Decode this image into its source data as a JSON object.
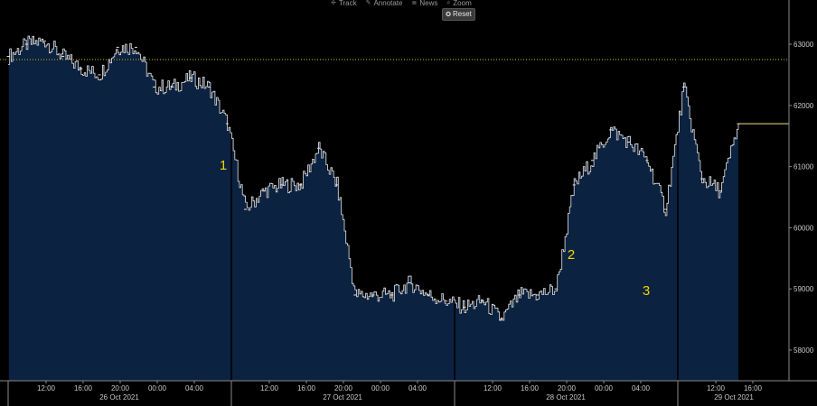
{
  "toolbar": {
    "track_label": "Track",
    "annotate_label": "Annotate",
    "news_label": "News",
    "zoom_label": "Zoom",
    "reset_label": "Reset"
  },
  "colors": {
    "background": "#000000",
    "area_fill": "#0b2240",
    "price_line": "#e6e6e6",
    "reference_line": "#d4c200",
    "annotation": "#f2d600",
    "last_price_line": "#f2e38a"
  },
  "chart_data": {
    "type": "area",
    "title": "",
    "xlabel": "",
    "ylabel": "",
    "ylim": [
      57500,
      63500
    ],
    "y_ticks": [
      58000,
      59000,
      60000,
      61000,
      62000,
      63000
    ],
    "reference_line": 62750,
    "x_hour_ticks": [
      "12:00",
      "16:00",
      "20:00",
      "00:00",
      "04:00",
      "12:00",
      "16:00",
      "20:00",
      "00:00",
      "04:00",
      "12:00",
      "16:00",
      "20:00",
      "00:00",
      "04:00",
      "12:00",
      "16:00"
    ],
    "x_date_labels": [
      "26 Oct 2021",
      "27 Oct 2021",
      "28 Oct 2021",
      "29 Oct 2021"
    ],
    "annotations": [
      "1",
      "2",
      "3"
    ],
    "x": [
      "26 Oct 06:00",
      "26 Oct 08:00",
      "26 Oct 10:00",
      "26 Oct 12:00",
      "26 Oct 14:00",
      "26 Oct 16:00",
      "26 Oct 18:00",
      "26 Oct 20:00",
      "26 Oct 22:00",
      "27 Oct 00:00",
      "27 Oct 02:00",
      "27 Oct 04:00",
      "27 Oct 06:00",
      "27 Oct 08:00",
      "27 Oct 10:00",
      "27 Oct 12:00",
      "27 Oct 14:00",
      "27 Oct 16:00",
      "27 Oct 18:00",
      "27 Oct 20:00",
      "27 Oct 22:00",
      "28 Oct 00:00",
      "28 Oct 02:00",
      "28 Oct 04:00",
      "28 Oct 06:00",
      "28 Oct 08:00",
      "28 Oct 10:00",
      "28 Oct 12:00",
      "28 Oct 14:00",
      "28 Oct 16:00",
      "28 Oct 18:00",
      "28 Oct 20:00",
      "28 Oct 22:00",
      "29 Oct 00:00",
      "29 Oct 02:00",
      "29 Oct 04:00",
      "29 Oct 06:00",
      "29 Oct 08:00",
      "29 Oct 10:00",
      "29 Oct 12:00",
      "29 Oct 14:00"
    ],
    "series": [
      {
        "values": [
          62800,
          63000,
          63050,
          62800,
          62600,
          62500,
          62950,
          62950,
          62300,
          62300,
          62450,
          62300,
          61700,
          60300,
          60600,
          60700,
          60700,
          61300,
          60700,
          58900,
          58900,
          58900,
          59100,
          58900,
          58800,
          58700,
          58800,
          58500,
          58900,
          58900,
          59000,
          60700,
          61100,
          61600,
          61400,
          61100,
          60300,
          62300,
          60800,
          60600,
          61700
        ]
      }
    ]
  }
}
